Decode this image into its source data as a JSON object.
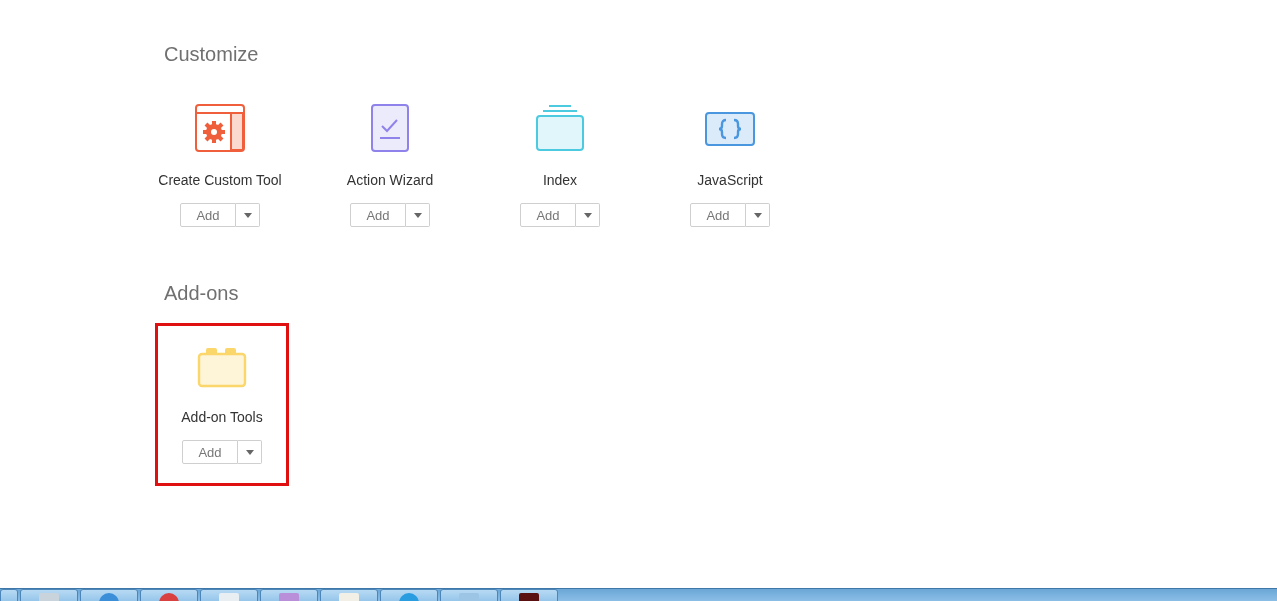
{
  "sections": [
    {
      "title": "Customize",
      "tools": [
        {
          "label": "Create Custom Tool",
          "kind": "custom",
          "button": "Add",
          "highlighted": false
        },
        {
          "label": "Action Wizard",
          "kind": "wizard",
          "button": "Add",
          "highlighted": false
        },
        {
          "label": "Index",
          "kind": "index",
          "button": "Add",
          "highlighted": false
        },
        {
          "label": "JavaScript",
          "kind": "script",
          "button": "Add",
          "highlighted": false
        }
      ]
    },
    {
      "title": "Add-ons",
      "tools": [
        {
          "label": "Add-on Tools",
          "kind": "addon",
          "button": "Add",
          "highlighted": true
        }
      ]
    }
  ]
}
